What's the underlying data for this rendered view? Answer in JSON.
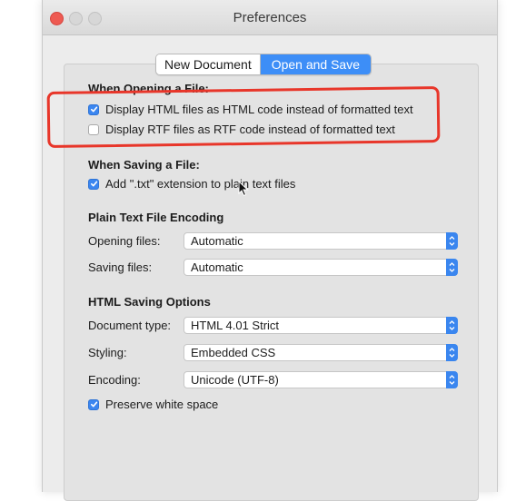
{
  "window": {
    "title": "Preferences"
  },
  "tabs": [
    {
      "label": "New Document",
      "active": false
    },
    {
      "label": "Open and Save",
      "active": true
    }
  ],
  "opening": {
    "heading": "When Opening a File:",
    "options": [
      {
        "label": "Display HTML files as HTML code instead of formatted text",
        "checked": true
      },
      {
        "label": "Display RTF files as RTF code instead of formatted text",
        "checked": false
      }
    ]
  },
  "saving": {
    "heading": "When Saving a File:",
    "options": [
      {
        "label": "Add \".txt\" extension to plain text files",
        "checked": true
      }
    ]
  },
  "encoding": {
    "heading": "Plain Text File Encoding",
    "opening_label": "Opening files:",
    "opening_value": "Automatic",
    "saving_label": "Saving files:",
    "saving_value": "Automatic"
  },
  "html_options": {
    "heading": "HTML Saving Options",
    "doctype_label": "Document type:",
    "doctype_value": "HTML 4.01 Strict",
    "styling_label": "Styling:",
    "styling_value": "Embedded CSS",
    "encoding_label": "Encoding:",
    "encoding_value": "Unicode (UTF-8)",
    "preserve_label": "Preserve white space",
    "preserve_checked": true
  },
  "colors": {
    "accent": "#3d8ef7",
    "annotation": "#e8362a",
    "close_button": "#ee5a52"
  },
  "icons": [
    "close-button-icon",
    "minimize-button-icon",
    "zoom-button-icon",
    "checkmark-icon",
    "popup-stepper-icon",
    "mouse-cursor-icon"
  ]
}
